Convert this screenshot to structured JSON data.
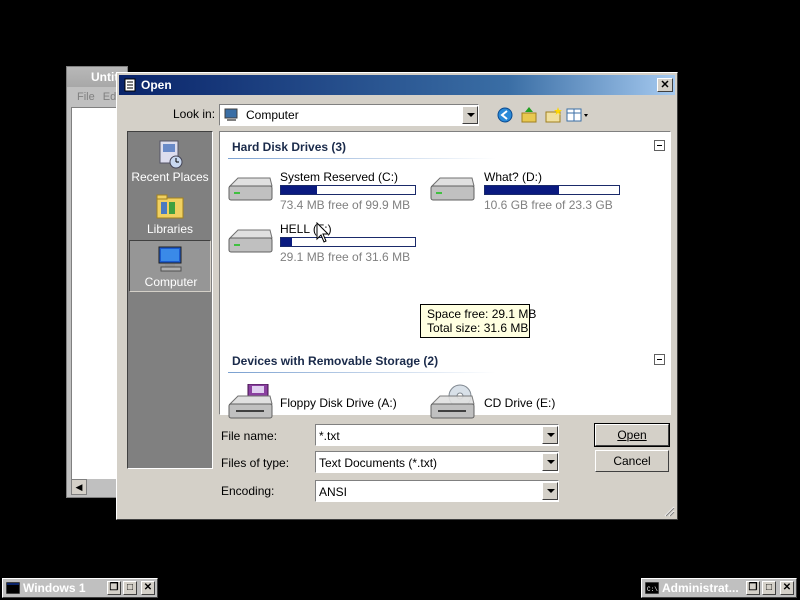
{
  "background_window": {
    "title": "Untitled",
    "menu": [
      "File",
      "Edit"
    ]
  },
  "dialog": {
    "title": "Open",
    "close_label": "✕",
    "look_in_label": "Look in:",
    "look_in_value": "Computer",
    "toolbar_icons": [
      "back-icon",
      "up-folder-icon",
      "new-folder-icon",
      "view-menu-icon"
    ]
  },
  "places": [
    {
      "label": "Recent Places",
      "icon": "recent-places-icon"
    },
    {
      "label": "Libraries",
      "icon": "libraries-icon"
    },
    {
      "label": "Computer",
      "icon": "computer-icon",
      "selected": true
    }
  ],
  "groups": [
    {
      "header": "Hard Disk Drives (3)",
      "drives": [
        {
          "name": "System Reserved (C:)",
          "free_text": "73.4 MB free of 99.9 MB",
          "used_fraction": 0.27
        },
        {
          "name": "What? (D:)",
          "free_text": "10.6 GB free of 23.3 GB",
          "used_fraction": 0.55
        },
        {
          "name": "HELL (F:)",
          "free_text": "29.1 MB free of 31.6 MB",
          "used_fraction": 0.08
        }
      ]
    },
    {
      "header": "Devices with Removable Storage (2)",
      "devices": [
        {
          "name": "Floppy Disk Drive (A:)",
          "icon": "floppy-drive-icon"
        },
        {
          "name": "CD Drive (E:)",
          "icon": "cd-drive-icon"
        }
      ]
    }
  ],
  "tooltip": {
    "line1": "Space free: 29.1 MB",
    "line2": "Total size: 31.6 MB"
  },
  "fields": {
    "file_name_label": "File name:",
    "file_name_value": "*.txt",
    "file_type_label": "Files of type:",
    "file_type_value": "Text Documents (*.txt)",
    "encoding_label": "Encoding:",
    "encoding_value": "ANSI"
  },
  "buttons": {
    "open": "Open",
    "cancel": "Cancel"
  },
  "taskbar": [
    {
      "title": "Windows 1"
    },
    {
      "title": "Administrat..."
    }
  ],
  "colors": {
    "title_gradient_start": "#0a246a",
    "title_gradient_end": "#a6caf0",
    "drive_fill": "#0a1a80",
    "tooltip_bg": "#ffffe1"
  }
}
